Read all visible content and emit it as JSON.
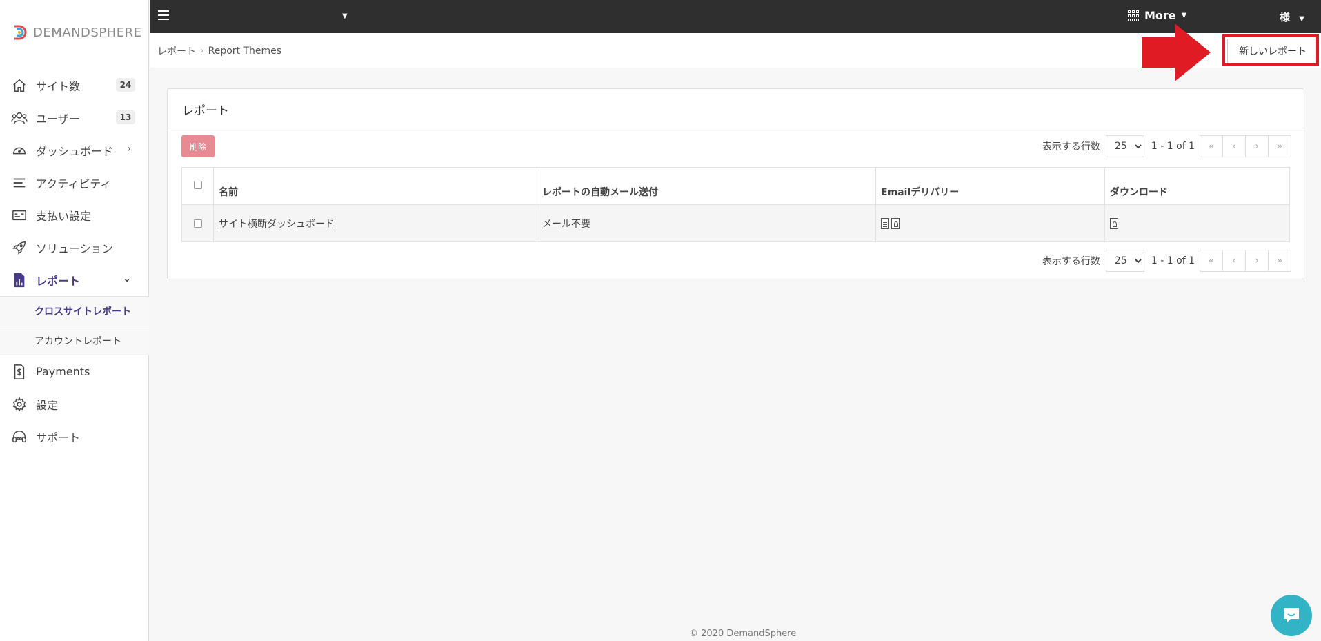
{
  "app": {
    "brand": "DEMANDSPHERE"
  },
  "sidebar": {
    "items": [
      {
        "label": "サイト数",
        "badge": "24",
        "icon": "home-icon"
      },
      {
        "label": "ユーザー",
        "badge": "13",
        "icon": "users-icon"
      },
      {
        "label": "ダッシュボード",
        "icon": "gauge-icon"
      },
      {
        "label": "アクティビティ",
        "icon": "list-icon"
      },
      {
        "label": "支払い設定",
        "icon": "card-icon"
      },
      {
        "label": "ソリューション",
        "icon": "rocket-icon"
      },
      {
        "label": "レポート",
        "icon": "report-icon"
      },
      {
        "label": "Payments",
        "icon": "receipt-icon"
      },
      {
        "label": "設定",
        "icon": "gear-icon"
      },
      {
        "label": "サポート",
        "icon": "headset-icon"
      }
    ],
    "sub_items": [
      {
        "label": "クロスサイトレポート"
      },
      {
        "label": "アカウントレポート"
      }
    ]
  },
  "topbar": {
    "more_label": "More",
    "user_label": "様"
  },
  "breadcrumb": {
    "root": "レポート",
    "current": "Report Themes"
  },
  "actions": {
    "new_report": "新しいレポート"
  },
  "card": {
    "title": "レポート",
    "delete_label": "削除",
    "pager": {
      "rows_label": "表示する行数",
      "rows_value": "25",
      "range_text": "1 - 1 of 1"
    },
    "columns": [
      "名前",
      "レポートの自動メール送付",
      "Emailデリバリー",
      "ダウンロード"
    ],
    "rows": [
      {
        "name": "サイト横断ダッシュボード",
        "email": "メール不要"
      }
    ]
  },
  "footer": {
    "text": "© 2020 DemandSphere"
  },
  "colors": {
    "accent": "#4a3a8c",
    "topbar": "#2f2f2f",
    "highlight": "#e01b24",
    "chat": "#33b4c6",
    "delete": "#e88a93"
  }
}
